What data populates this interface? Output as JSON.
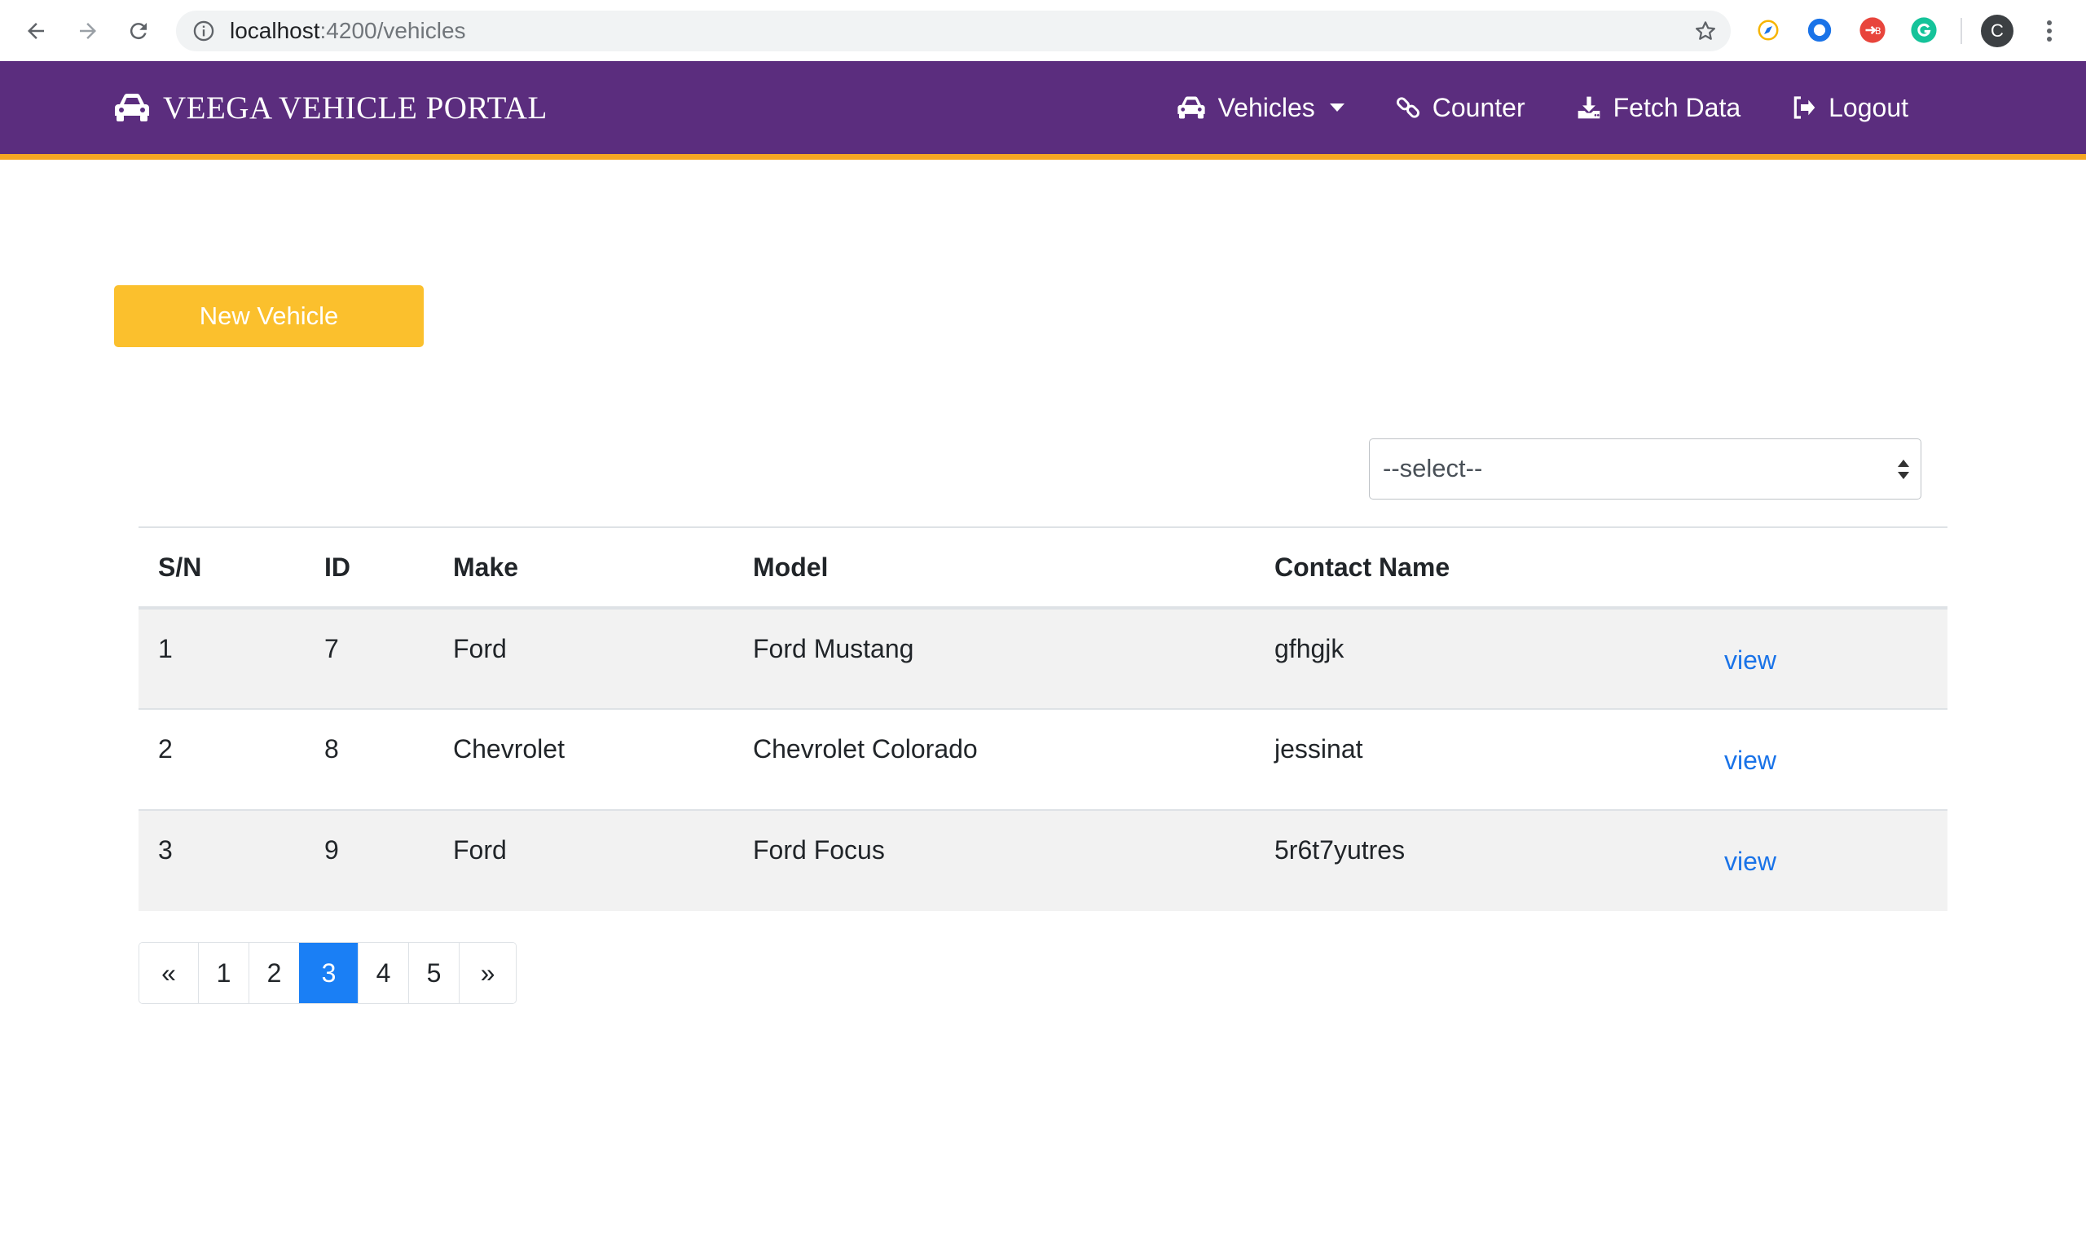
{
  "browser": {
    "url_host": "localhost",
    "url_path": ":4200/vehicles",
    "profile_initial": "C"
  },
  "navbar": {
    "brand": "VEEGA VEHICLE PORTAL",
    "links": [
      {
        "label": "Vehicles",
        "icon": "car-icon"
      },
      {
        "label": "Counter",
        "icon": "link-icon"
      },
      {
        "label": "Fetch Data",
        "icon": "download-icon"
      },
      {
        "label": "Logout",
        "icon": "logout-icon"
      }
    ],
    "colors": {
      "background": "#5b2d7e",
      "accent_border": "#f5a623"
    }
  },
  "actions": {
    "new_vehicle_label": "New Vehicle"
  },
  "filter": {
    "selected": "--select--"
  },
  "table": {
    "headers": [
      "S/N",
      "ID",
      "Make",
      "Model",
      "Contact Name",
      ""
    ],
    "rows": [
      {
        "sn": "1",
        "id": "7",
        "make": "Ford",
        "model": "Ford Mustang",
        "contact": "gfhgjk",
        "action": "view"
      },
      {
        "sn": "2",
        "id": "8",
        "make": "Chevrolet",
        "model": "Chevrolet Colorado",
        "contact": "jessinat",
        "action": "view"
      },
      {
        "sn": "3",
        "id": "9",
        "make": "Ford",
        "model": "Ford Focus",
        "contact": "5r6t7yutres",
        "action": "view"
      }
    ]
  },
  "pagination": {
    "prev": "«",
    "pages": [
      "1",
      "2",
      "3",
      "4",
      "5"
    ],
    "active_page": "3",
    "next": "»"
  }
}
